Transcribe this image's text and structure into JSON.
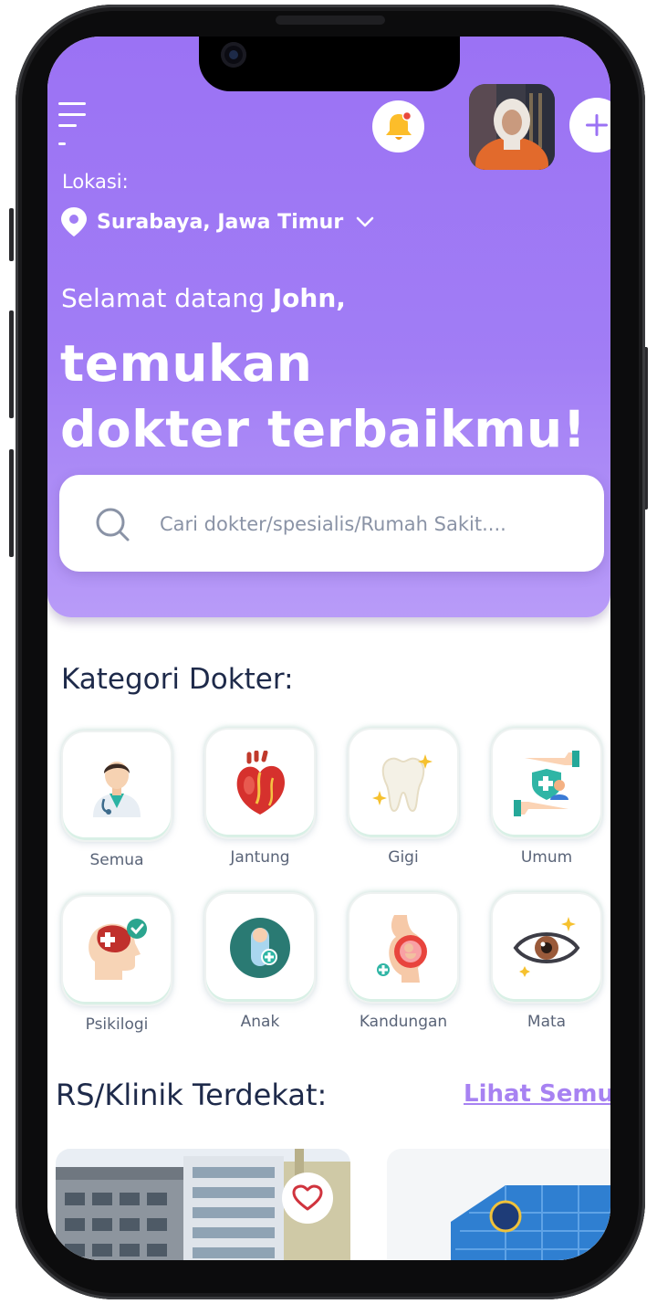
{
  "colors": {
    "header_gradient_top": "#9b72f4",
    "header_gradient_bottom": "#b89bf8",
    "accent": "#a782f2",
    "title_text": "#1e2a4a",
    "label_text": "#5a6478",
    "placeholder_text": "#8a93a6"
  },
  "header": {
    "location_label": "Lokasi:",
    "location_value": "Surabaya, Jawa Timur",
    "greeting_prefix": "Selamat datang ",
    "greeting_name": "John,",
    "headline_line1": "temukan",
    "headline_line2": "dokter terbaikmu!",
    "icons": {
      "menu": "menu-icon",
      "notification": "bell-icon",
      "add": "plus-icon",
      "location": "map-pin-icon",
      "dropdown": "chevron-down-icon"
    }
  },
  "search": {
    "placeholder": "Cari dokter/spesialis/Rumah Sakit....",
    "icon": "search-icon"
  },
  "categories": {
    "title": "Kategori Dokter:",
    "items": [
      {
        "label": "Semua",
        "icon": "doctor-icon"
      },
      {
        "label": "Jantung",
        "icon": "heart-organ-icon"
      },
      {
        "label": "Gigi",
        "icon": "tooth-icon"
      },
      {
        "label": "Umum",
        "icon": "health-care-icon"
      },
      {
        "label": "Psikilogi",
        "icon": "brain-icon"
      },
      {
        "label": "Anak",
        "icon": "baby-icon"
      },
      {
        "label": "Kandungan",
        "icon": "pregnancy-icon"
      },
      {
        "label": "Mata",
        "icon": "eye-icon"
      }
    ]
  },
  "clinics": {
    "title": "RS/Klinik Terdekat:",
    "see_all": "Lihat Semua",
    "favorite_icon": "heart-outline-icon"
  }
}
